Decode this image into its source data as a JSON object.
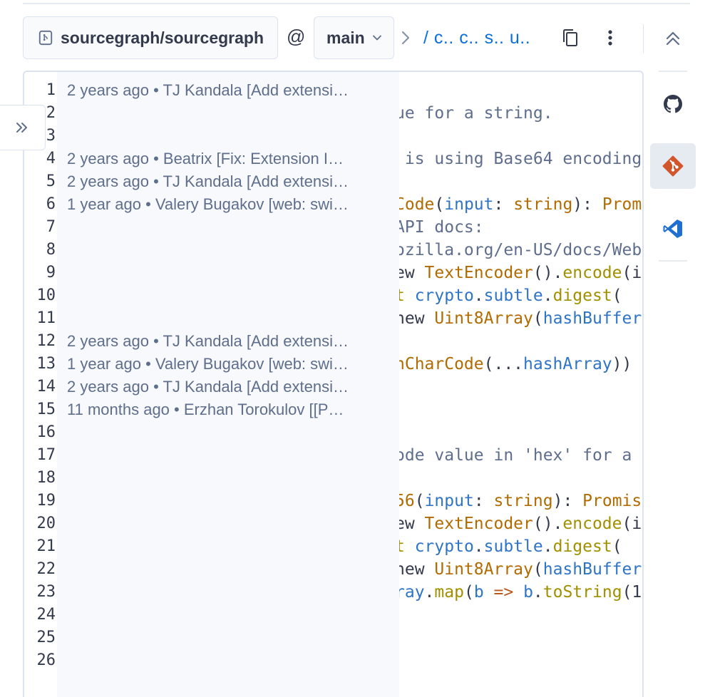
{
  "header": {
    "repo_name": "sourcegraph/sourcegraph",
    "at_sign": "@",
    "branch": "main",
    "breadcrumb_path": "/ c.. c.. s.. u.."
  },
  "editor": {
    "line_numbers": [
      "1",
      "2",
      "3",
      "4",
      "5",
      "6",
      "7",
      "8",
      "9",
      "10",
      "11",
      "12",
      "13",
      "14",
      "15",
      "16",
      "17",
      "18",
      "19",
      "20",
      "21",
      "22",
      "23",
      "24",
      "25",
      "26"
    ],
    "blame": [
      "2 years ago • TJ Kandala [Add extensi…",
      "",
      "",
      "2 years ago • Beatrix [Fix: Extension I…",
      "2 years ago • TJ Kandala [Add extensi…",
      "1 year ago • Valery Bugakov [web: swi…",
      "",
      "",
      "",
      "",
      "",
      "2 years ago • TJ Kandala [Add extensi…",
      "1 year ago • Valery Bugakov [web: swi…",
      "2 years ago • TJ Kandala [Add extensi…",
      "11 months ago • Erzhan Torokulov [[P…"
    ],
    "code": [
      [
        {
          "t": "ue for a string.",
          "c": "c"
        }
      ],
      [],
      [
        {
          "t": " is using Base64 encoding",
          "c": "c"
        }
      ],
      [],
      [
        {
          "t": "Code",
          "c": "f"
        },
        {
          "t": "(",
          "c": "p"
        },
        {
          "t": "input",
          "c": "b"
        },
        {
          "t": ": ",
          "c": "p"
        },
        {
          "t": "string",
          "c": "f"
        },
        {
          "t": "): ",
          "c": "p"
        },
        {
          "t": "Prom",
          "c": "f"
        }
      ],
      [
        {
          "t": "API docs:",
          "c": "c"
        }
      ],
      [
        {
          "t": "ozilla.org/en-US/docs/Web",
          "c": "c"
        }
      ],
      [
        {
          "t": "ew ",
          "c": "p"
        },
        {
          "t": "TextEncoder",
          "c": "f"
        },
        {
          "t": "().",
          "c": "p"
        },
        {
          "t": "encode",
          "c": "y"
        },
        {
          "t": "(i",
          "c": "p"
        }
      ],
      [
        {
          "t": "t ",
          "c": "y"
        },
        {
          "t": "crypto",
          "c": "b"
        },
        {
          "t": ".",
          "c": "p"
        },
        {
          "t": "subtle",
          "c": "b"
        },
        {
          "t": ".",
          "c": "p"
        },
        {
          "t": "digest",
          "c": "y"
        },
        {
          "t": "(",
          "c": "p"
        }
      ],
      [
        {
          "t": "new ",
          "c": "p"
        },
        {
          "t": "Uint8Array",
          "c": "f"
        },
        {
          "t": "(",
          "c": "p"
        },
        {
          "t": "hashBuffer",
          "c": "b"
        }
      ],
      [],
      [
        {
          "t": "nCharCode",
          "c": "f"
        },
        {
          "t": "(...",
          "c": "p"
        },
        {
          "t": "hashArray",
          "c": "b"
        },
        {
          "t": "))",
          "c": "p"
        }
      ],
      [],
      [],
      [],
      [
        {
          "t": "ode value in 'hex' for a",
          "c": "c"
        }
      ],
      [],
      [
        {
          "t": "56",
          "c": "f"
        },
        {
          "t": "(",
          "c": "p"
        },
        {
          "t": "input",
          "c": "b"
        },
        {
          "t": ": ",
          "c": "p"
        },
        {
          "t": "string",
          "c": "f"
        },
        {
          "t": "): ",
          "c": "p"
        },
        {
          "t": "Promis",
          "c": "f"
        }
      ],
      [
        {
          "t": "ew ",
          "c": "p"
        },
        {
          "t": "TextEncoder",
          "c": "f"
        },
        {
          "t": "().",
          "c": "p"
        },
        {
          "t": "encode",
          "c": "y"
        },
        {
          "t": "(i",
          "c": "p"
        }
      ],
      [
        {
          "t": "t ",
          "c": "y"
        },
        {
          "t": "crypto",
          "c": "b"
        },
        {
          "t": ".",
          "c": "p"
        },
        {
          "t": "subtle",
          "c": "b"
        },
        {
          "t": ".",
          "c": "p"
        },
        {
          "t": "digest",
          "c": "y"
        },
        {
          "t": "(",
          "c": "p"
        }
      ],
      [
        {
          "t": "new ",
          "c": "p"
        },
        {
          "t": "Uint8Array",
          "c": "f"
        },
        {
          "t": "(",
          "c": "p"
        },
        {
          "t": "hashBuffer",
          "c": "b"
        }
      ],
      [
        {
          "t": "ray",
          "c": "b"
        },
        {
          "t": ".",
          "c": "p"
        },
        {
          "t": "map",
          "c": "y"
        },
        {
          "t": "(",
          "c": "p"
        },
        {
          "t": "b ",
          "c": "b"
        },
        {
          "t": "=> ",
          "c": "k"
        },
        {
          "t": "b",
          "c": "b"
        },
        {
          "t": ".",
          "c": "p"
        },
        {
          "t": "toString",
          "c": "y"
        },
        {
          "t": "(1",
          "c": "p"
        }
      ]
    ]
  },
  "rail": {
    "items": [
      "github-icon",
      "git-icon",
      "vscode-icon"
    ],
    "active": "git-icon"
  },
  "colors": {
    "accent_link": "#0b70db",
    "git_orange": "#d2562c",
    "vscode_blue": "#1f6fd0"
  }
}
